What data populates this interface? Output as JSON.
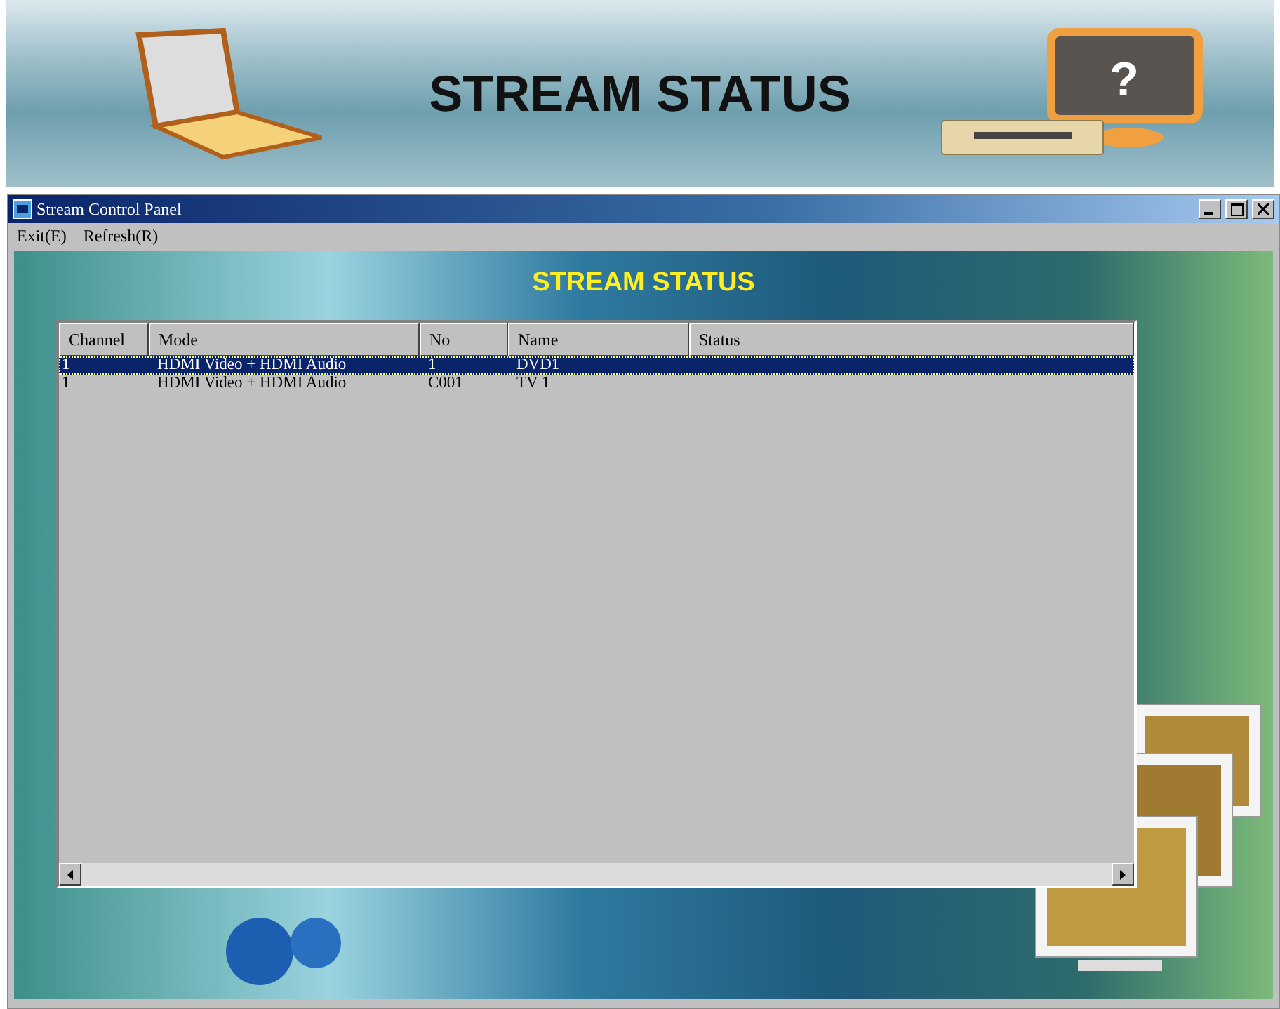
{
  "banner": {
    "title": "STREAM STATUS",
    "help_glyph": "?"
  },
  "window": {
    "title": "Stream Control Panel"
  },
  "menu": [
    {
      "label": "Exit(E)"
    },
    {
      "label": "Refresh(R)"
    }
  ],
  "content": {
    "heading": "STREAM STATUS"
  },
  "table": {
    "columns": [
      "Channel",
      "Mode",
      "No",
      "Name",
      "Status"
    ],
    "rows": [
      {
        "selected": true,
        "cells": [
          "1",
          "HDMI Video + HDMI Audio",
          "1",
          "DVD1",
          ""
        ]
      },
      {
        "selected": false,
        "cells": [
          "1",
          "HDMI Video + HDMI Audio",
          "C001",
          "TV 1",
          ""
        ]
      }
    ]
  }
}
